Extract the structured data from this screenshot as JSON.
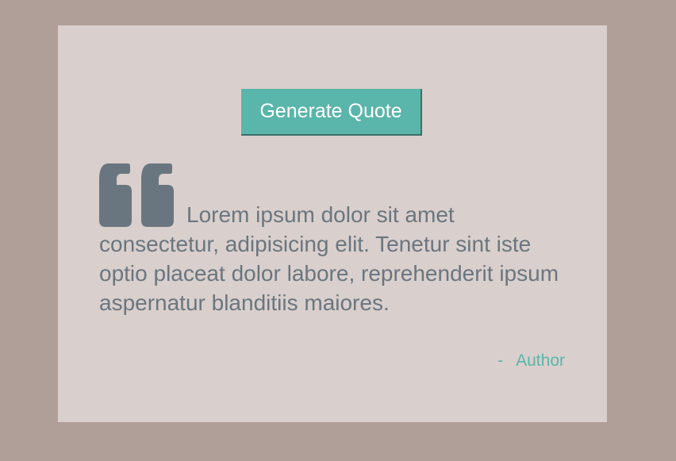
{
  "controls": {
    "generate_label": "Generate Quote"
  },
  "quote": {
    "text": "Lorem ipsum dolor sit amet consectetur, adipisicing elit. Tenetur sint iste optio placeat dolor labore, reprehenderit ipsum aspernatur blanditiis maiores.",
    "icon": "quote-left-icon",
    "author_prefix": "-",
    "author": "Author"
  },
  "colors": {
    "page_background": "#b09f98",
    "card_background": "#d9cfcc",
    "accent": "#5ab5aa",
    "quote_text": "#6a767f"
  }
}
